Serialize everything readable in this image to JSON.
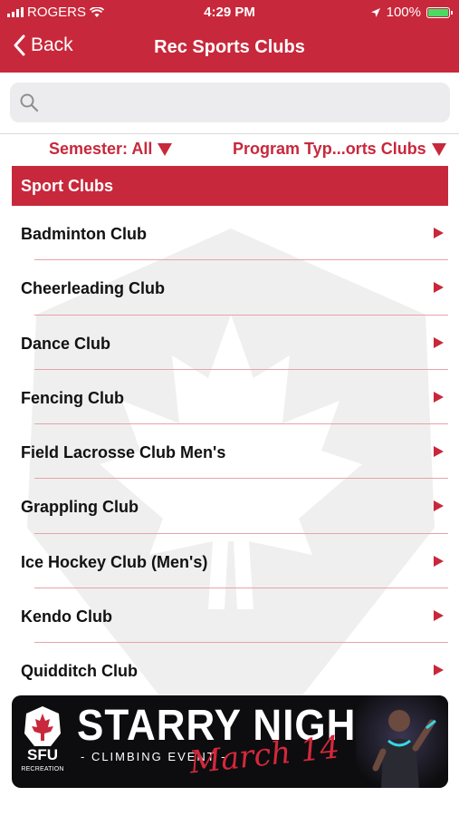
{
  "status_bar": {
    "carrier": "ROGERS",
    "time": "4:29 PM",
    "battery": "100%"
  },
  "navbar": {
    "back_label": "Back",
    "title": "Rec Sports Clubs"
  },
  "search": {
    "placeholder": "",
    "value": ""
  },
  "filters": {
    "semester": "Semester: All",
    "program_type": "Program Typ...orts Clubs"
  },
  "section": {
    "title": "Sport Clubs"
  },
  "clubs": [
    "Badminton Club",
    "Cheerleading Club",
    "Dance Club",
    "Fencing Club",
    "Field Lacrosse Club Men's",
    "Grappling Club",
    "Ice Hockey Club (Men's)",
    "Kendo Club",
    "Quidditch Club"
  ],
  "banner": {
    "logo_text": "SFU",
    "logo_subtext": "RECREATION",
    "title": "STARRY NIGHT",
    "subtitle": "- CLIMBING EVENT -",
    "date": "March 14"
  },
  "colors": {
    "brand_red": "#c8283b",
    "separator": "#e6a3ac",
    "search_bg": "#ececee"
  }
}
